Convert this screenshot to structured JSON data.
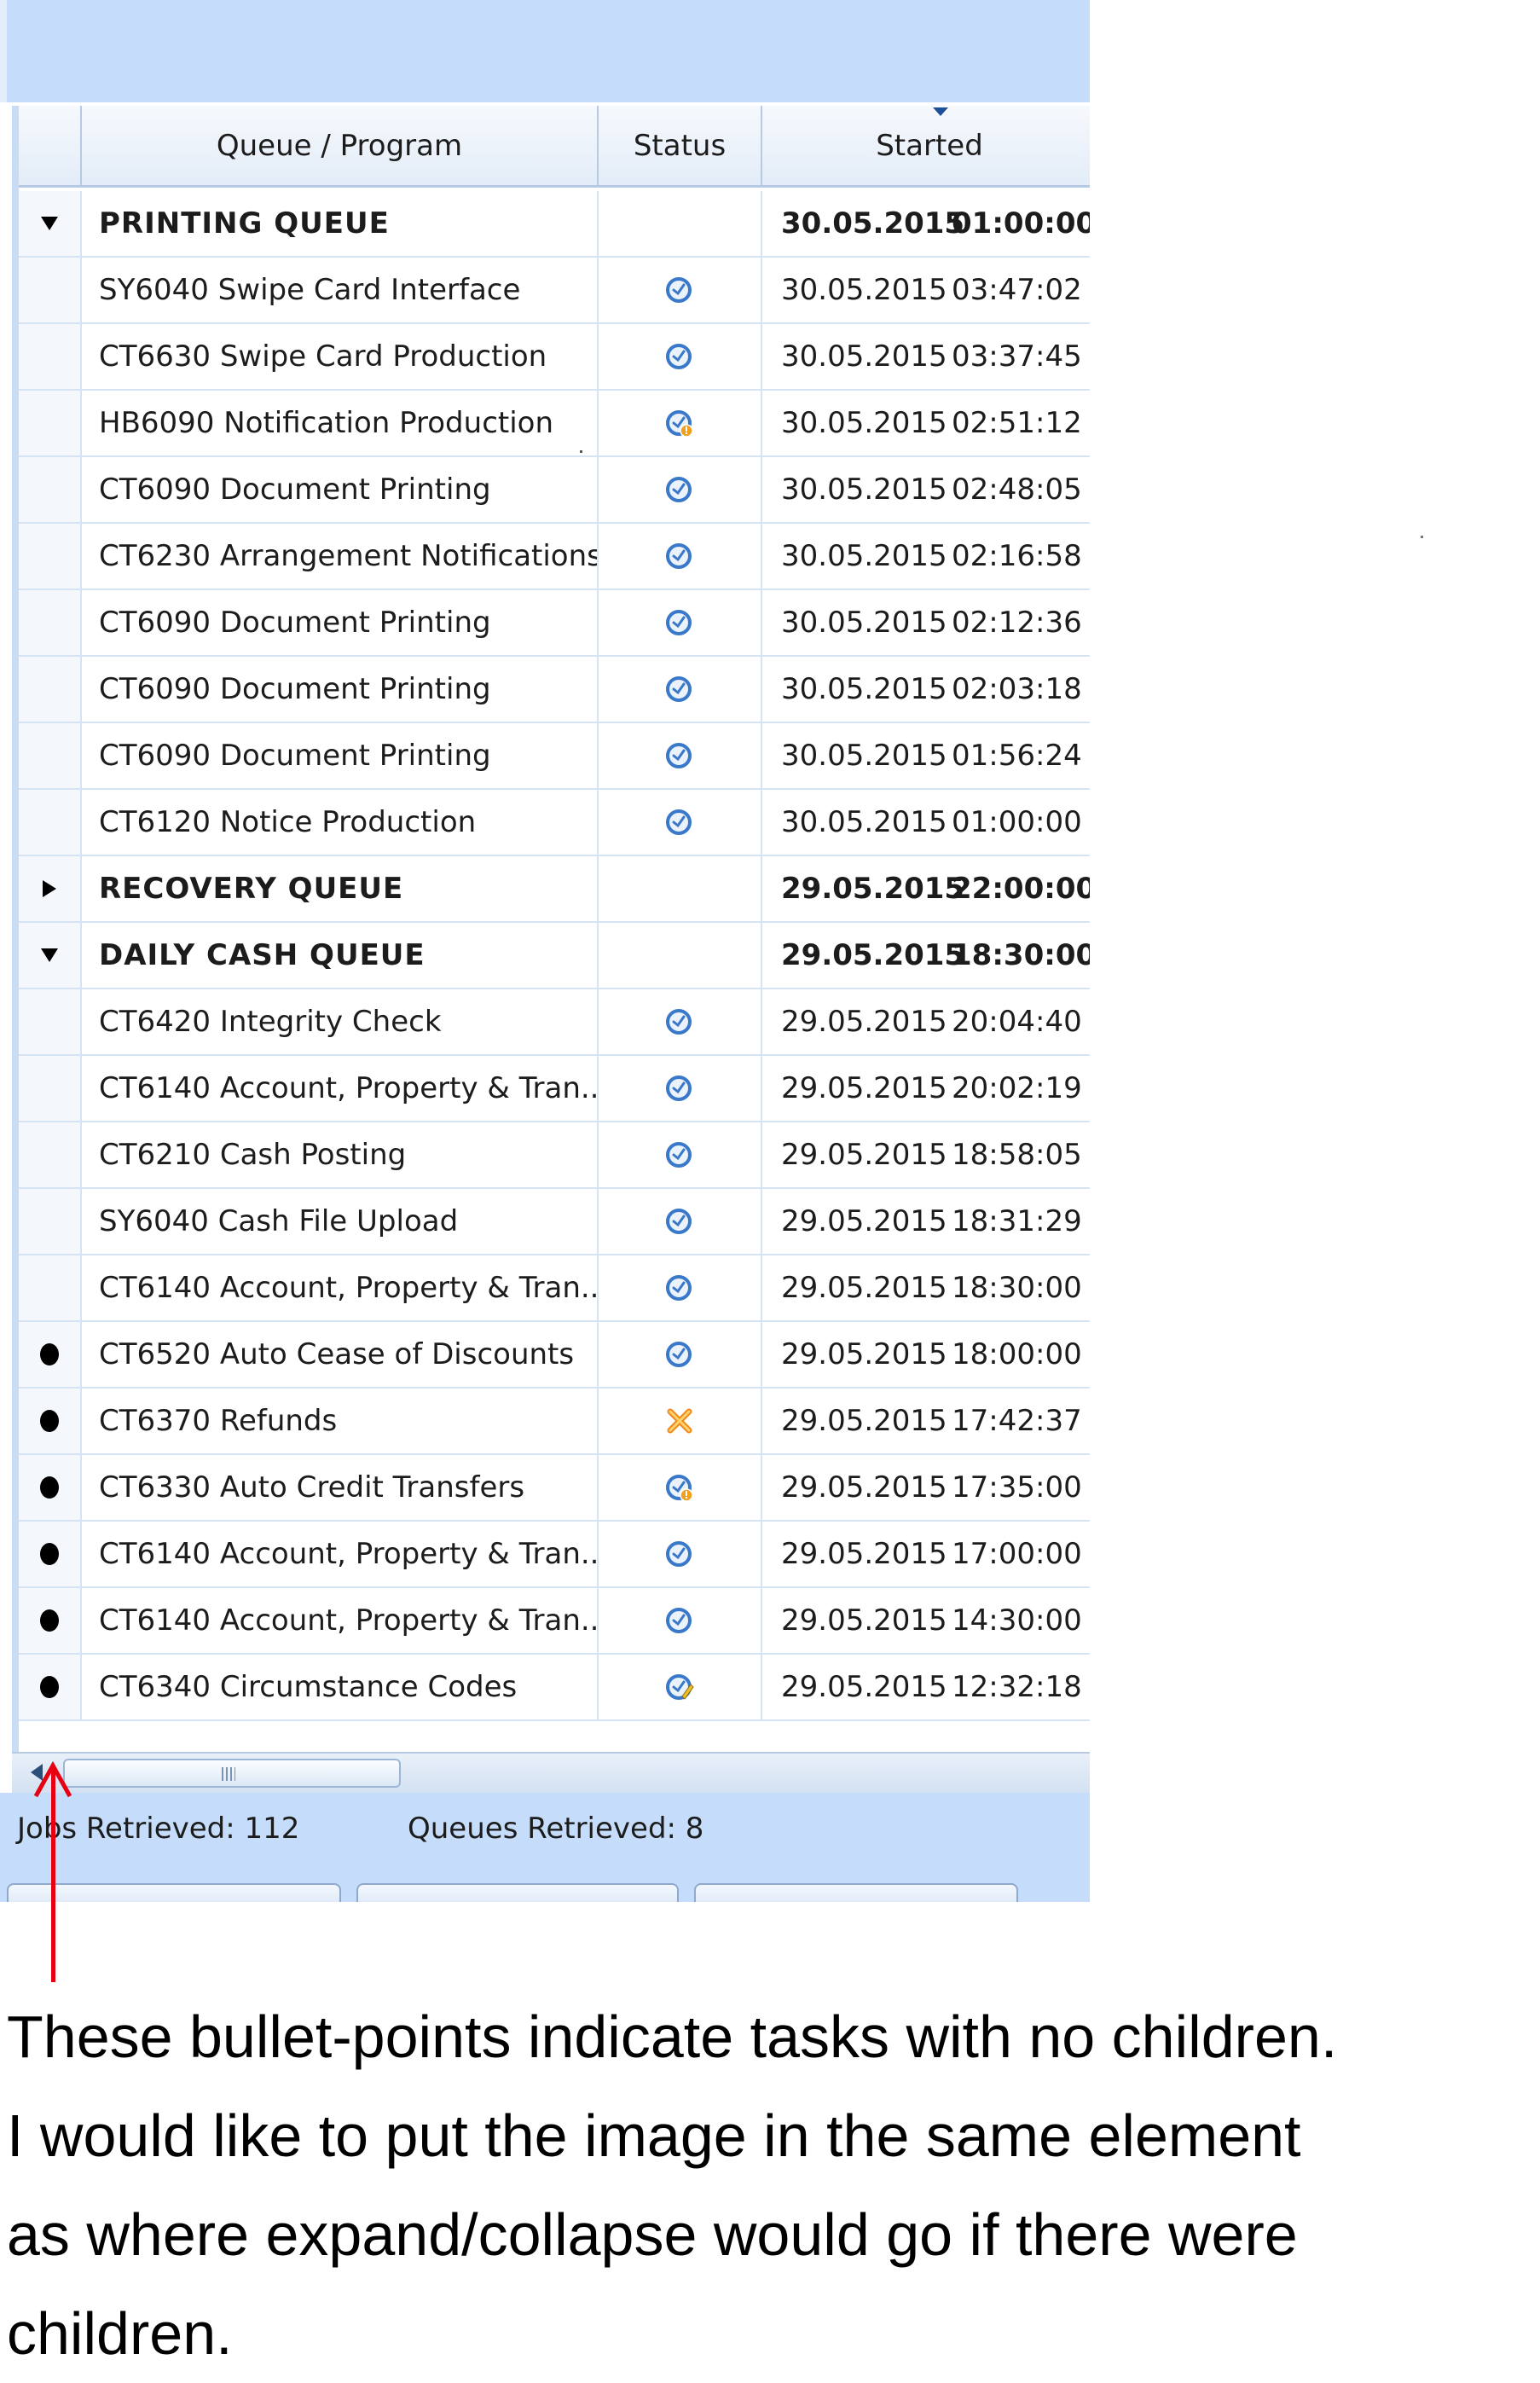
{
  "grid": {
    "columns": [
      "Queue / Program",
      "Status",
      "Started"
    ],
    "rows": [
      {
        "kind": "group",
        "marker": "collapse",
        "name": "PRINTING QUEUE",
        "status": "",
        "date": "30.05.2015",
        "time": "01:00:00"
      },
      {
        "kind": "child",
        "marker": "",
        "name": "SY6040 Swipe Card Interface",
        "status": "completed",
        "date": "30.05.2015",
        "time": "03:47:02"
      },
      {
        "kind": "child",
        "marker": "",
        "name": "CT6630 Swipe Card Production",
        "status": "completed",
        "date": "30.05.2015",
        "time": "03:37:45"
      },
      {
        "kind": "child",
        "marker": "",
        "name": "HB6090 Notification Production",
        "status": "warning",
        "date": "30.05.2015",
        "time": "02:51:12"
      },
      {
        "kind": "child",
        "marker": "",
        "name": "CT6090 Document Printing",
        "status": "completed",
        "date": "30.05.2015",
        "time": "02:48:05"
      },
      {
        "kind": "child",
        "marker": "",
        "name": "CT6230 Arrangement Notifications",
        "status": "completed",
        "date": "30.05.2015",
        "time": "02:16:58"
      },
      {
        "kind": "child",
        "marker": "",
        "name": "CT6090 Document Printing",
        "status": "completed",
        "date": "30.05.2015",
        "time": "02:12:36"
      },
      {
        "kind": "child",
        "marker": "",
        "name": "CT6090 Document Printing",
        "status": "completed",
        "date": "30.05.2015",
        "time": "02:03:18"
      },
      {
        "kind": "child",
        "marker": "",
        "name": "CT6090 Document Printing",
        "status": "completed",
        "date": "30.05.2015",
        "time": "01:56:24"
      },
      {
        "kind": "child",
        "marker": "",
        "name": "CT6120 Notice Production",
        "status": "completed",
        "date": "30.05.2015",
        "time": "01:00:00"
      },
      {
        "kind": "group",
        "marker": "expand",
        "name": "RECOVERY QUEUE",
        "status": "",
        "date": "29.05.2015",
        "time": "22:00:00"
      },
      {
        "kind": "group",
        "marker": "collapse",
        "name": "DAILY CASH QUEUE",
        "status": "",
        "date": "29.05.2015",
        "time": "18:30:00"
      },
      {
        "kind": "child",
        "marker": "",
        "name": "CT6420 Integrity Check",
        "status": "completed",
        "date": "29.05.2015",
        "time": "20:04:40"
      },
      {
        "kind": "child",
        "marker": "",
        "name": "CT6140 Account, Property & Tran..",
        "status": "completed",
        "date": "29.05.2015",
        "time": "20:02:19"
      },
      {
        "kind": "child",
        "marker": "",
        "name": "CT6210 Cash Posting",
        "status": "completed",
        "date": "29.05.2015",
        "time": "18:58:05"
      },
      {
        "kind": "child",
        "marker": "",
        "name": "SY6040 Cash File Upload",
        "status": "completed",
        "date": "29.05.2015",
        "time": "18:31:29"
      },
      {
        "kind": "child",
        "marker": "",
        "name": "CT6140 Account, Property & Tran..",
        "status": "completed",
        "date": "29.05.2015",
        "time": "18:30:00"
      },
      {
        "kind": "task",
        "marker": "bullet",
        "name": "CT6520 Auto Cease of Discounts",
        "status": "completed",
        "date": "29.05.2015",
        "time": "18:00:00"
      },
      {
        "kind": "task",
        "marker": "bullet",
        "name": "CT6370 Refunds",
        "status": "failed",
        "date": "29.05.2015",
        "time": "17:42:37"
      },
      {
        "kind": "task",
        "marker": "bullet",
        "name": "CT6330 Auto Credit Transfers",
        "status": "warning",
        "date": "29.05.2015",
        "time": "17:35:00"
      },
      {
        "kind": "task",
        "marker": "bullet",
        "name": "CT6140 Account, Property & Tran..",
        "status": "completed",
        "date": "29.05.2015",
        "time": "17:00:00"
      },
      {
        "kind": "task",
        "marker": "bullet",
        "name": "CT6140 Account, Property & Tran..",
        "status": "completed",
        "date": "29.05.2015",
        "time": "14:30:00"
      },
      {
        "kind": "task",
        "marker": "bullet",
        "name": "CT6340 Circumstance Codes",
        "status": "edited",
        "date": "29.05.2015",
        "time": "12:32:18"
      }
    ]
  },
  "statusbar": {
    "jobs": "Jobs Retrieved: 112",
    "queues": "Queues Retrieved: 8"
  },
  "annotation": {
    "lines": [
      "These bullet-points indicate tasks with no children.",
      "I would like to put the image in the same element",
      "as where expand/collapse would go if there were",
      "children."
    ],
    "arrow_color": "#e60012"
  },
  "colors": {
    "panel_bg": "#c5ddfa",
    "grid_line": "#d6e3f2",
    "status_blue": "#3a78c9",
    "status_warning": "#f0a020",
    "status_failed": "#f08a1c"
  }
}
